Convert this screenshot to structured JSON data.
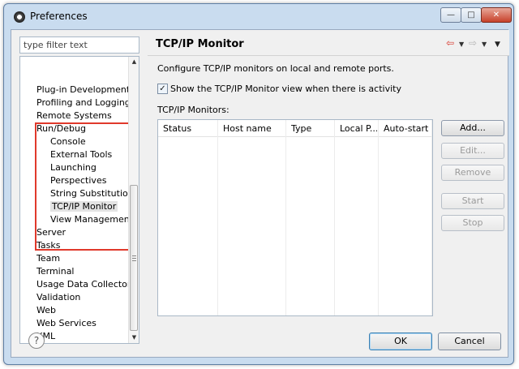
{
  "window": {
    "title": "Preferences",
    "min_label": "—",
    "max_label": "□",
    "close_label": "✕"
  },
  "filter": {
    "placeholder": "type filter text"
  },
  "tree": {
    "items": [
      {
        "label": "Plug-in Development",
        "level": 0
      },
      {
        "label": "Profiling and Logging",
        "level": 0
      },
      {
        "label": "Remote Systems",
        "level": 0
      },
      {
        "label": "Run/Debug",
        "level": 0
      },
      {
        "label": "Console",
        "level": 1
      },
      {
        "label": "External Tools",
        "level": 1
      },
      {
        "label": "Launching",
        "level": 1
      },
      {
        "label": "Perspectives",
        "level": 1
      },
      {
        "label": "String Substitution",
        "level": 1
      },
      {
        "label": "TCP/IP Monitor",
        "level": 1,
        "selected": true
      },
      {
        "label": "View Management",
        "level": 1
      },
      {
        "label": "Server",
        "level": 0
      },
      {
        "label": "Tasks",
        "level": 0
      },
      {
        "label": "Team",
        "level": 0
      },
      {
        "label": "Terminal",
        "level": 0
      },
      {
        "label": "Usage Data Collector",
        "level": 0
      },
      {
        "label": "Validation",
        "level": 0
      },
      {
        "label": "Web",
        "level": 0
      },
      {
        "label": "Web Services",
        "level": 0
      },
      {
        "label": "XML",
        "level": 0
      }
    ]
  },
  "page": {
    "title": "TCP/IP Monitor",
    "description": "Configure TCP/IP monitors on local and remote ports.",
    "checkbox_label": "Show the TCP/IP Monitor view when there is activity",
    "checkbox_checked": true,
    "list_label": "TCP/IP Monitors:",
    "columns": [
      "Status",
      "Host name",
      "Type",
      "Local P...",
      "Auto-start"
    ]
  },
  "buttons": {
    "add": "Add...",
    "edit": "Edit...",
    "remove": "Remove",
    "start": "Start",
    "stop": "Stop",
    "ok": "OK",
    "cancel": "Cancel"
  },
  "icons": {
    "back": "back-arrow-icon",
    "forward": "forward-arrow-icon",
    "help": "help-icon"
  },
  "colors": {
    "highlight_border": "#e0392b",
    "back_arrow": "#d83a2f"
  }
}
